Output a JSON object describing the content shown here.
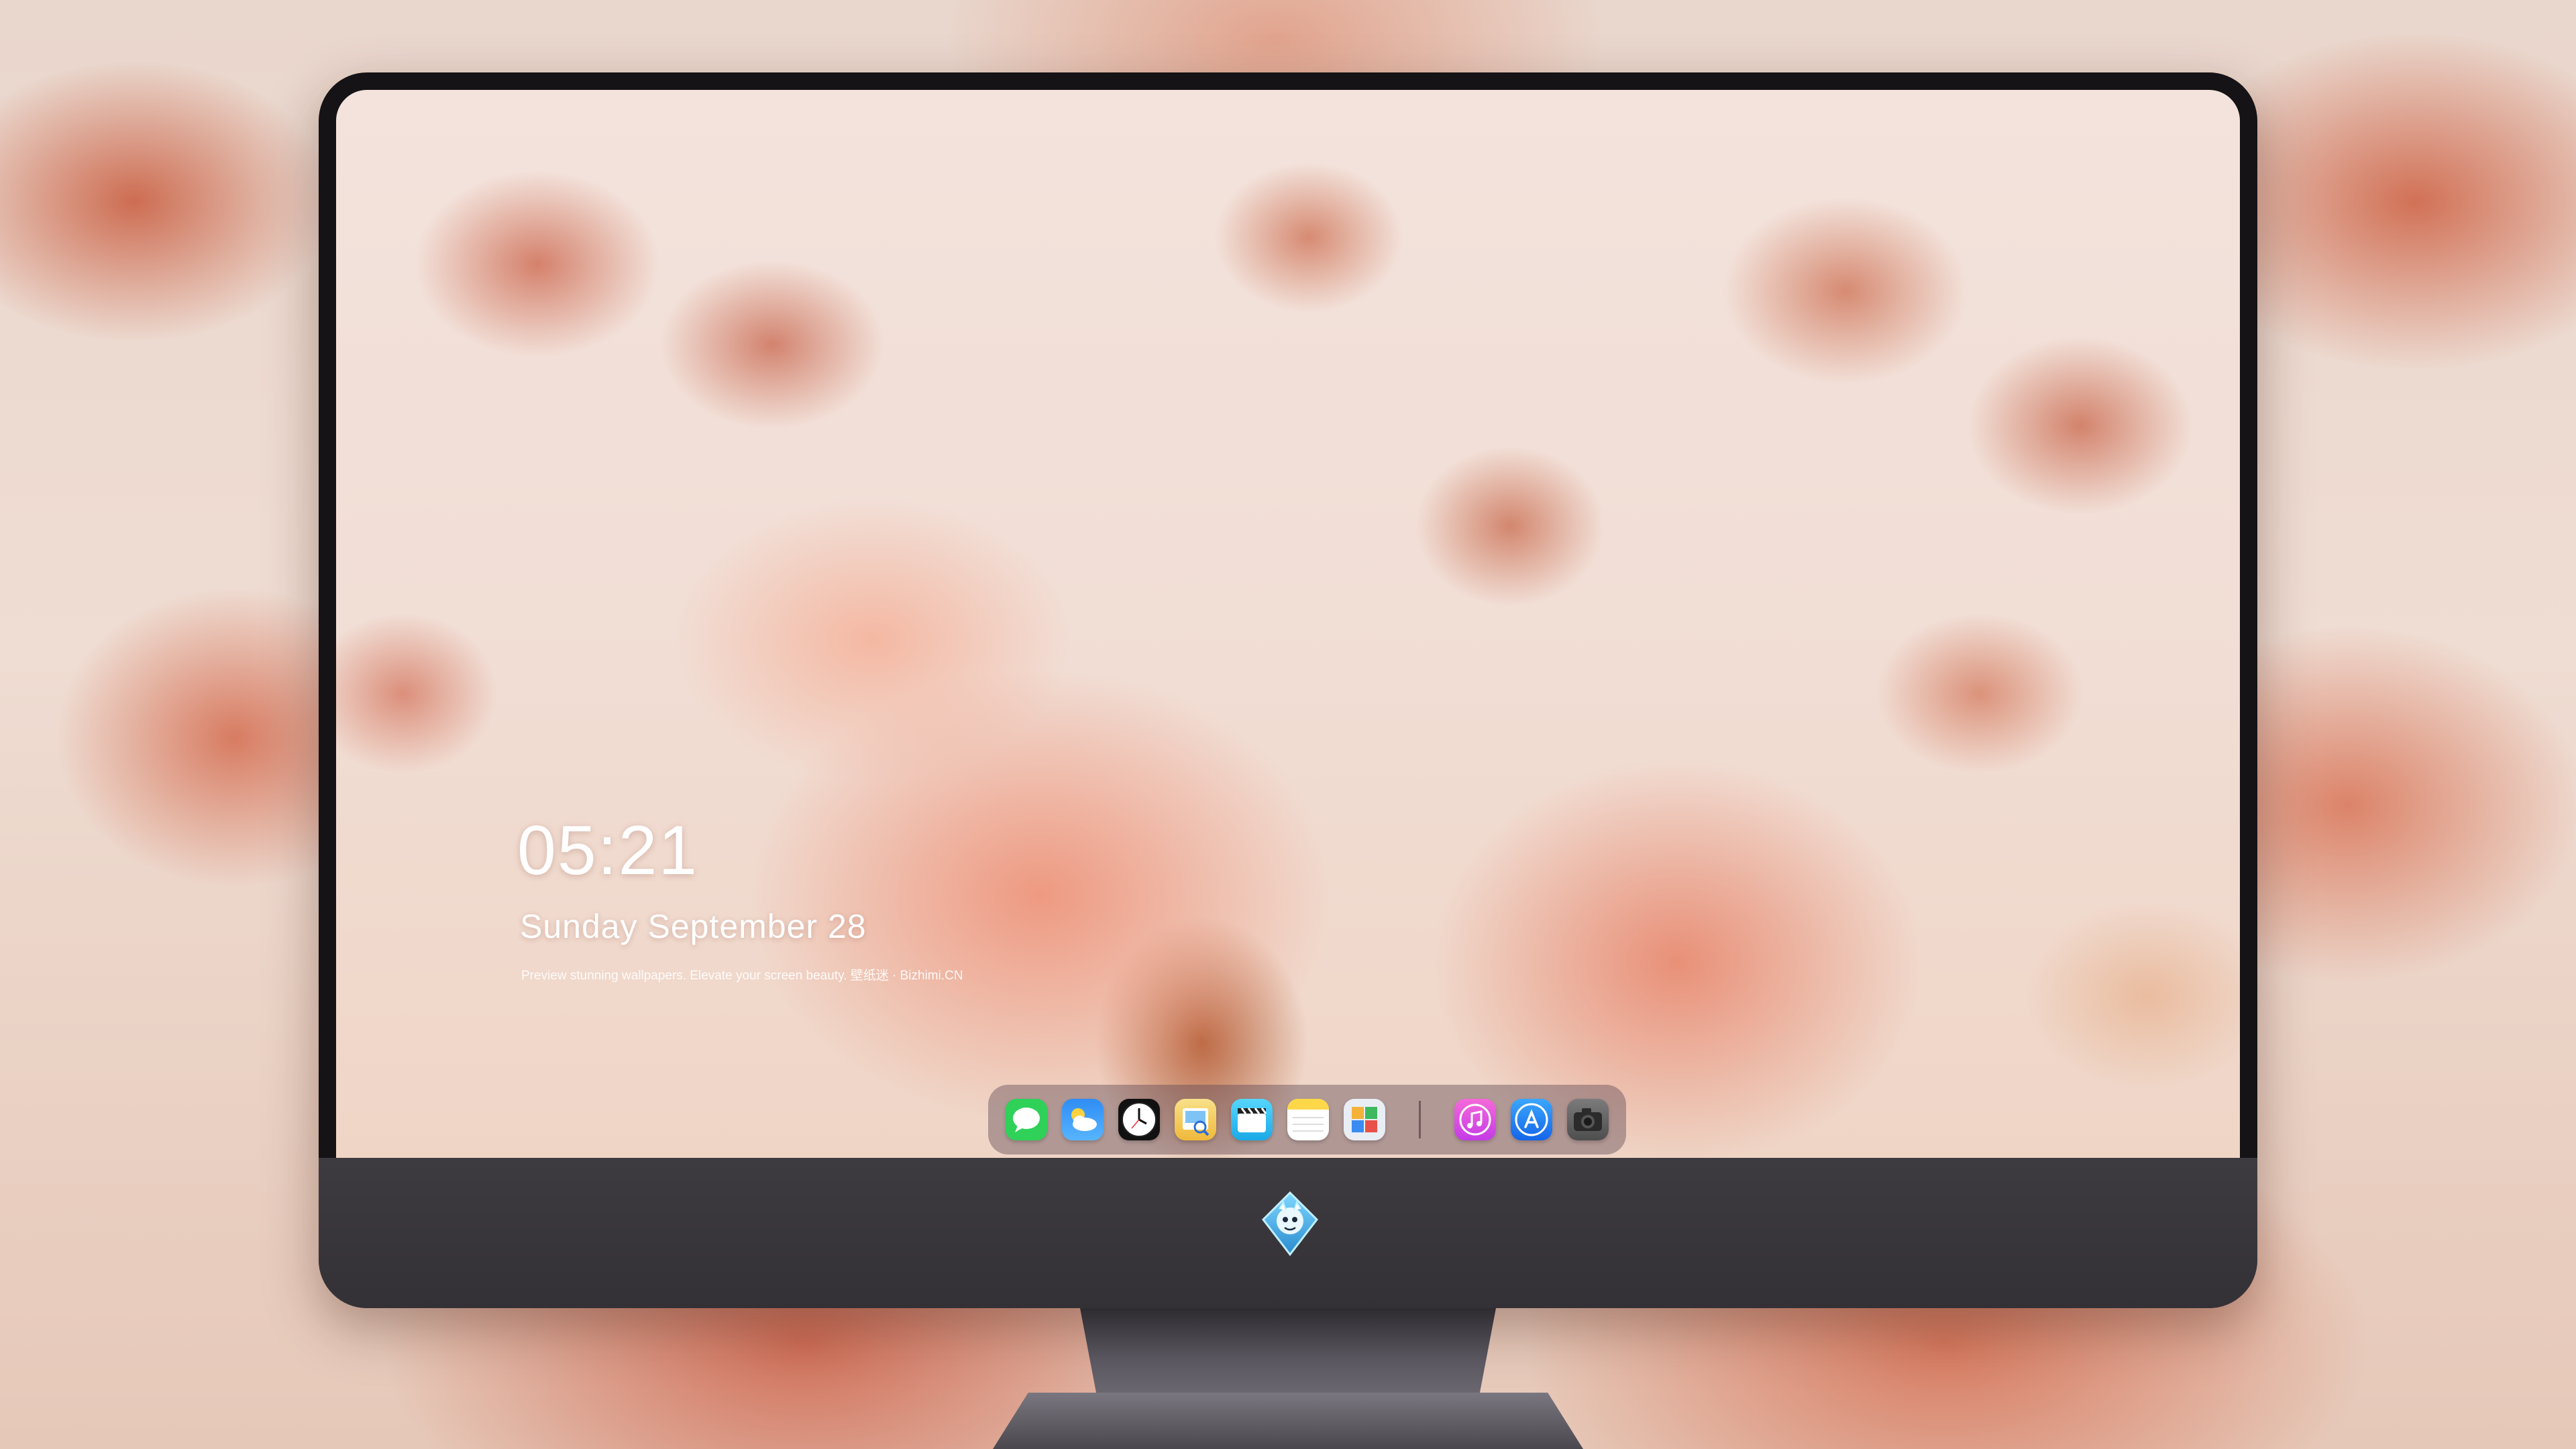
{
  "lock_screen": {
    "time": "05:21",
    "date": "Sunday September  28",
    "caption": "Preview stunning wallpapers. Elevate your screen beauty. 壁纸迷 · Bizhimi.CN"
  },
  "dock": {
    "apps": [
      {
        "name": "Messages",
        "icon": "messages-icon",
        "color": "#2fd158"
      },
      {
        "name": "Weather",
        "icon": "weather-icon",
        "color": "#2f8df5"
      },
      {
        "name": "Clock",
        "icon": "clock-icon",
        "color": "#ffffff"
      },
      {
        "name": "Preview",
        "icon": "preview-icon",
        "color": "#f5c542"
      },
      {
        "name": "Clips",
        "icon": "clips-icon",
        "color": "#3fc8ff"
      },
      {
        "name": "Notes",
        "icon": "notes-icon",
        "color": "#ffd84a"
      },
      {
        "name": "Photos",
        "icon": "photos-icon",
        "color": "#e9eef5"
      },
      {
        "name": "Music",
        "icon": "music-icon",
        "color": "#e64fd8"
      },
      {
        "name": "App Store",
        "icon": "app-store-icon",
        "color": "#1d8cf8"
      },
      {
        "name": "Camera",
        "icon": "camera-icon",
        "color": "#6a6a6a"
      }
    ]
  },
  "monitor": {
    "chin_logo": "dragon-logo-icon"
  },
  "colors": {
    "bezel": "#151316",
    "chin": "#3e3b40",
    "wallpaper_accent": "#e8917a"
  }
}
